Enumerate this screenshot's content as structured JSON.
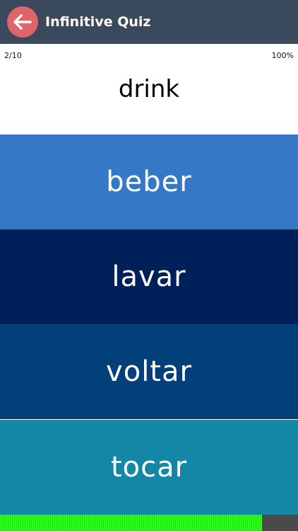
{
  "header": {
    "title": "Infinitive Quiz",
    "back_icon": "arrow-left-icon",
    "back_color": "#e0646b",
    "bar_color": "#3a4a5c"
  },
  "quiz": {
    "counter": "2/10",
    "percent": "100%",
    "word": "drink",
    "options": [
      "beber",
      "lavar",
      "voltar",
      "tocar"
    ],
    "option_colors": [
      "#3478c6",
      "#00205a",
      "#033f79",
      "#1486a6"
    ]
  },
  "progress": {
    "fraction": 0.88,
    "fill_color": "#2bff18",
    "track_color": "#4a4a4a"
  }
}
